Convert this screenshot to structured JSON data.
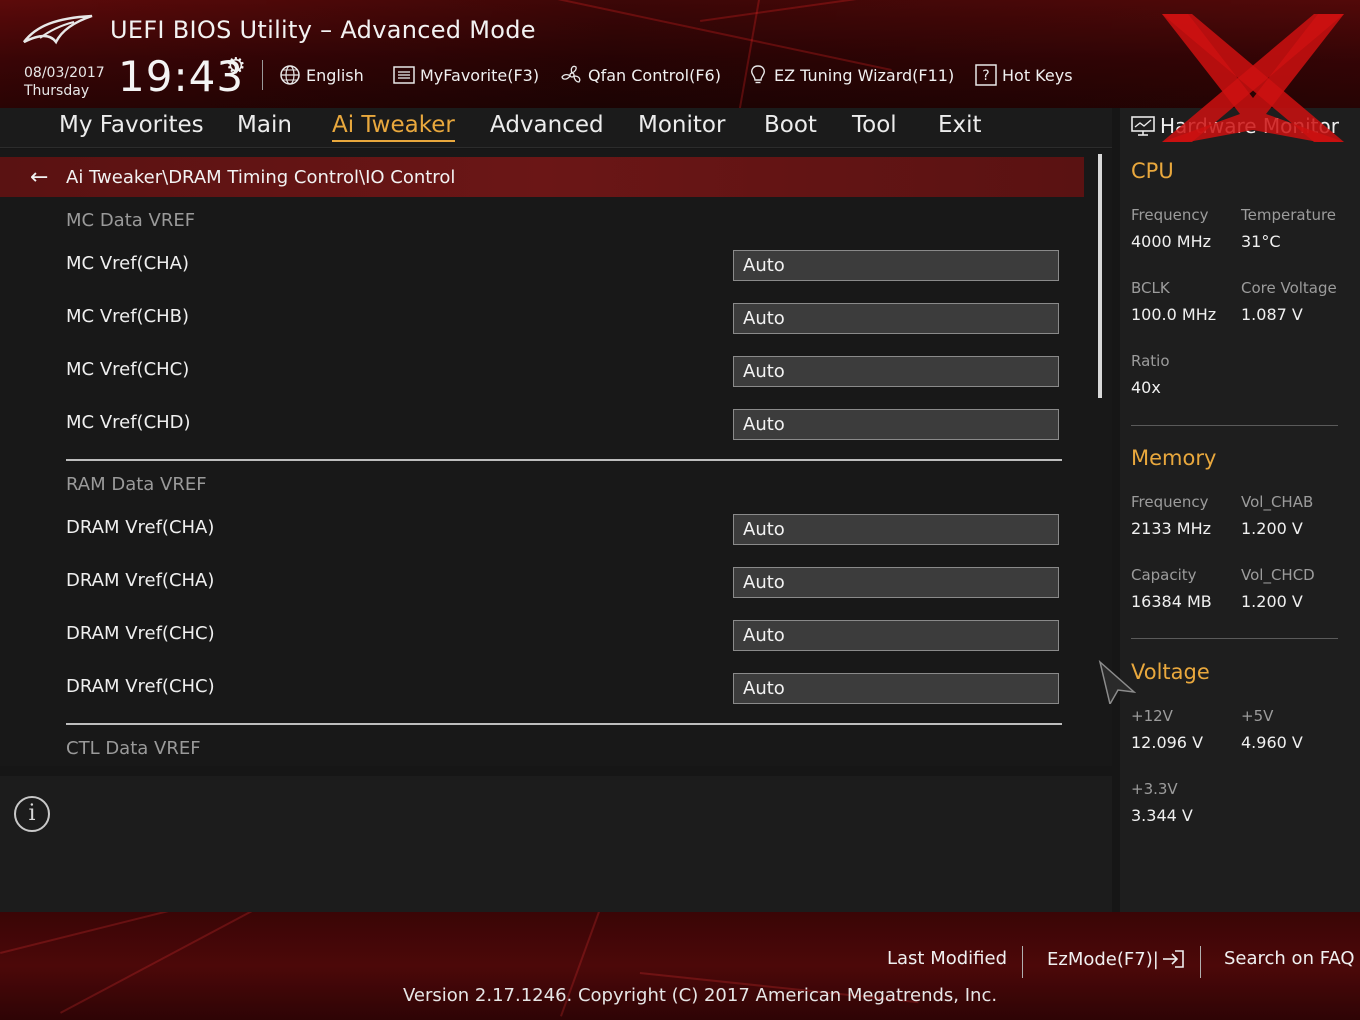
{
  "app": {
    "title": "UEFI BIOS Utility – Advanced Mode"
  },
  "datetime": {
    "date": "08/03/2017",
    "day": "Thursday",
    "time": "19:43"
  },
  "toolbar": {
    "language": "English",
    "my_favorite": "MyFavorite(F3)",
    "qfan": "Qfan Control(F6)",
    "ez_tuning": "EZ Tuning Wizard(F11)",
    "hot_keys": "Hot Keys"
  },
  "nav": {
    "tabs": [
      {
        "label": "My Favorites",
        "active": false
      },
      {
        "label": "Main",
        "active": false
      },
      {
        "label": "Ai Tweaker",
        "active": true
      },
      {
        "label": "Advanced",
        "active": false
      },
      {
        "label": "Monitor",
        "active": false
      },
      {
        "label": "Boot",
        "active": false
      },
      {
        "label": "Tool",
        "active": false
      },
      {
        "label": "Exit",
        "active": false
      }
    ]
  },
  "breadcrumb": {
    "path": "Ai Tweaker\\DRAM Timing Control\\IO Control"
  },
  "sections": [
    {
      "title": "MC Data VREF",
      "rows": [
        {
          "label": "MC Vref(CHA)",
          "value": "Auto"
        },
        {
          "label": "MC Vref(CHB)",
          "value": "Auto"
        },
        {
          "label": "MC Vref(CHC)",
          "value": "Auto"
        },
        {
          "label": "MC Vref(CHD)",
          "value": "Auto"
        }
      ]
    },
    {
      "title": "RAM Data VREF",
      "rows": [
        {
          "label": "DRAM Vref(CHA)",
          "value": "Auto"
        },
        {
          "label": "DRAM Vref(CHA)",
          "value": "Auto"
        },
        {
          "label": "DRAM Vref(CHC)",
          "value": "Auto"
        },
        {
          "label": "DRAM Vref(CHC)",
          "value": "Auto"
        }
      ]
    },
    {
      "title": "CTL Data VREF",
      "rows": []
    }
  ],
  "hardware_monitor": {
    "title": "Hardware Monitor",
    "cpu": {
      "title": "CPU",
      "frequency_label": "Frequency",
      "frequency": "4000 MHz",
      "temperature_label": "Temperature",
      "temperature": "31°C",
      "bclk_label": "BCLK",
      "bclk": "100.0 MHz",
      "core_voltage_label": "Core Voltage",
      "core_voltage": "1.087 V",
      "ratio_label": "Ratio",
      "ratio": "40x"
    },
    "memory": {
      "title": "Memory",
      "frequency_label": "Frequency",
      "frequency": "2133 MHz",
      "vol_chab_label": "Vol_CHAB",
      "vol_chab": "1.200 V",
      "capacity_label": "Capacity",
      "capacity": "16384 MB",
      "vol_chcd_label": "Vol_CHCD",
      "vol_chcd": "1.200 V"
    },
    "voltage": {
      "title": "Voltage",
      "v12_label": "+12V",
      "v12": "12.096 V",
      "v5_label": "+5V",
      "v5": "4.960 V",
      "v33_label": "+3.3V",
      "v33": "3.344 V"
    }
  },
  "footer": {
    "last_modified": "Last Modified",
    "ezmode": "EzMode(F7)|",
    "search_faq": "Search on FAQ",
    "version": "Version 2.17.1246. Copyright (C) 2017 American Megatrends, Inc."
  },
  "colors": {
    "accent": "#e9a83d",
    "header_red": "#5c0a0a",
    "crumb_red": "#6b1616",
    "watermark_red": "#cc1111"
  }
}
